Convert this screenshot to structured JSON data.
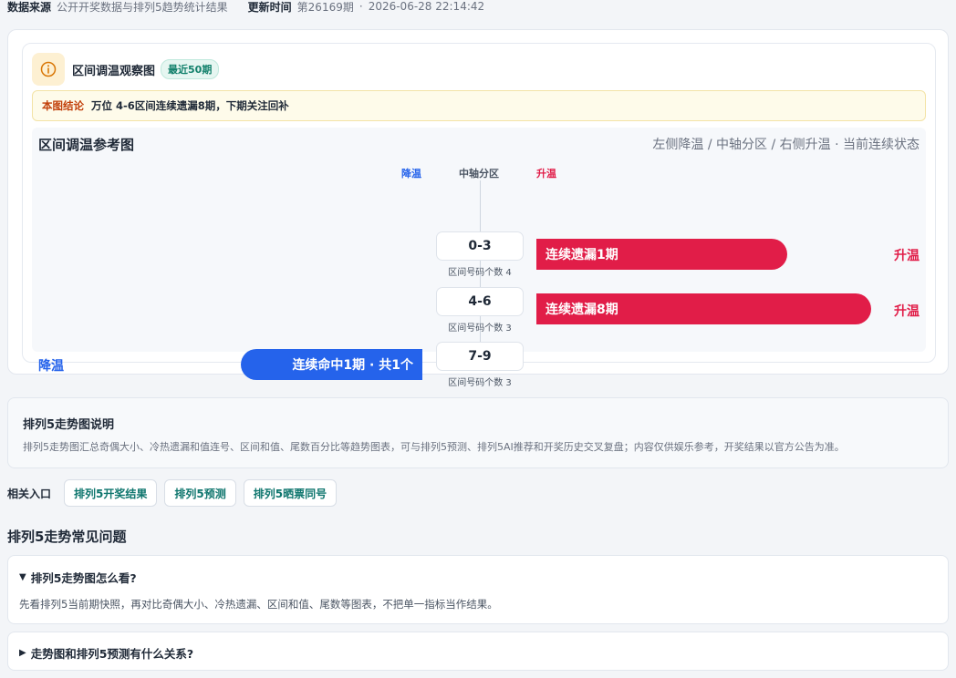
{
  "meta": {
    "source_label": "数据来源",
    "source_value": "公开开奖数据与排列5趋势统计结果",
    "update_label": "更新时间",
    "update_issue": "第26169期",
    "update_sep": "·",
    "update_time": "2026-06-28 22:14:42"
  },
  "panel": {
    "title": "区间调温观察图",
    "badge": "最近50期",
    "conclusion_label": "本图结论",
    "conclusion_text": "万位 4-6区间连续遗漏8期，下期关注回补"
  },
  "chart": {
    "title": "区间调温参考图",
    "subtitle": "左侧降温 / 中轴分区 / 右侧升温 · 当前连续状态",
    "col_left": "降温",
    "col_mid": "中轴分区",
    "col_right": "升温",
    "rows": [
      {
        "zone": "0-3",
        "count": "区间号码个数 4",
        "side": "right",
        "bar_label": "连续遗漏1期",
        "tag": "升温"
      },
      {
        "zone": "4-6",
        "count": "区间号码个数 3",
        "side": "right",
        "bar_label": "连续遗漏8期",
        "tag": "升温"
      },
      {
        "zone": "7-9",
        "count": "区间号码个数 3",
        "side": "left",
        "bar_label": "连续命中1期 · 共1个",
        "tag": "降温"
      }
    ]
  },
  "chart_data": {
    "type": "bar",
    "title": "区间调温参考图",
    "categories": [
      "0-3",
      "4-6",
      "7-9"
    ],
    "series": [
      {
        "name": "升温",
        "values": [
          1,
          8,
          0
        ]
      },
      {
        "name": "降温",
        "values": [
          0,
          0,
          1
        ]
      }
    ]
  },
  "description": {
    "title": "排列5走势图说明",
    "body": "排列5走势图汇总奇偶大小、冷热遗漏和值连号、区间和值、尾数百分比等趋势图表，可与排列5预测、排列5AI推荐和开奖历史交叉复盘；内容仅供娱乐参考，开奖结果以官方公告为准。"
  },
  "links": {
    "label": "相关入口",
    "items": [
      "排列5开奖结果",
      "排列5预测",
      "排列5晒票同号"
    ]
  },
  "faq": {
    "heading": "排列5走势常见问题",
    "items": [
      {
        "toggle": "▼",
        "question": "排列5走势图怎么看?",
        "answer": "先看排列5当前期快照，再对比奇偶大小、冷热遗漏、区间和值、尾数等图表，不把单一指标当作结果。"
      },
      {
        "toggle": "▶",
        "question": "走势图和排列5预测有什么关系?"
      }
    ]
  }
}
